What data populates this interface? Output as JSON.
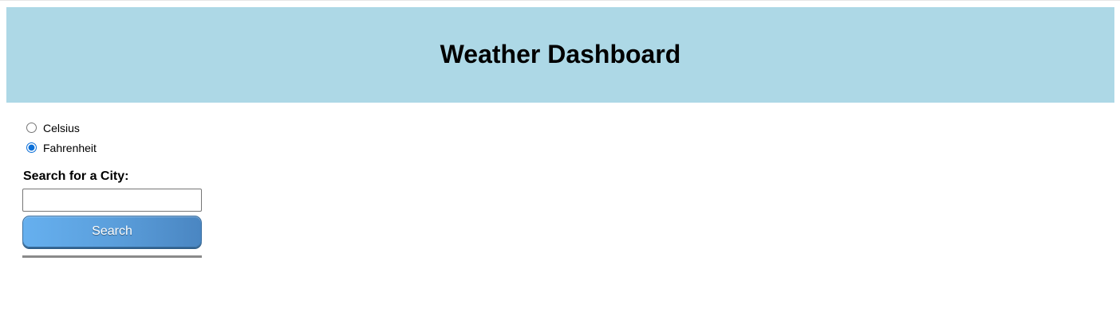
{
  "header": {
    "title": "Weather Dashboard"
  },
  "units": {
    "options": [
      {
        "label": "Celsius",
        "value": "celsius",
        "checked": false
      },
      {
        "label": "Fahrenheit",
        "value": "fahrenheit",
        "checked": true
      }
    ],
    "selected": "Fahrenheit"
  },
  "search": {
    "label": "Search for a City:",
    "value": "",
    "placeholder": "",
    "button_label": "Search"
  },
  "colors": {
    "header_bg": "#add8e6",
    "button_blue": "#5b9fdc",
    "divider": "#8a8a8a"
  }
}
